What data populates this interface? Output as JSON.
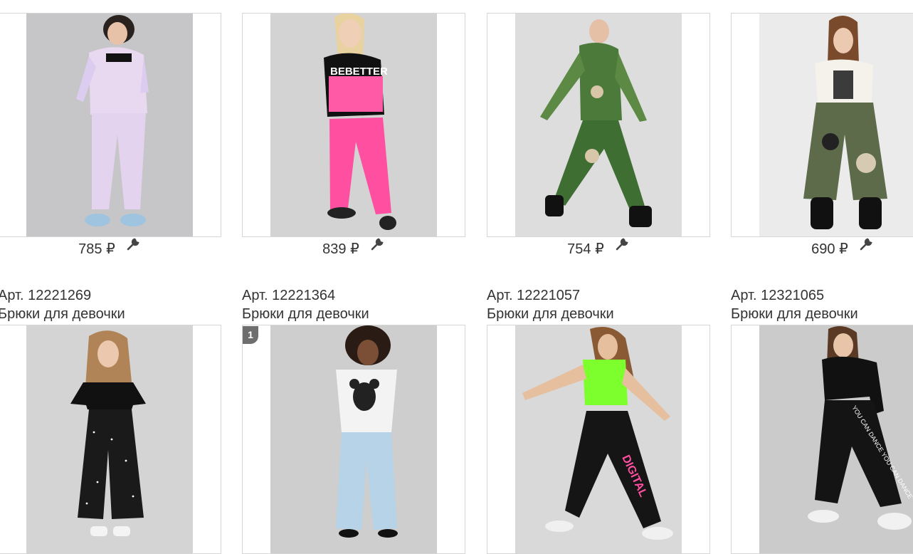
{
  "products": [
    {
      "price": "785 ₽",
      "sku": "Арт. 12221269",
      "name": "Брюки для девочки",
      "photo": "girl in pastel tie-dye hoodie and joggers",
      "bg": "#c9c9cb"
    },
    {
      "price": "839 ₽",
      "sku": "Арт. 12221364",
      "name": "Брюки для девочки",
      "photo": "girl in black and pink hoodie, pink joggers",
      "bg": "#d4d4d4"
    },
    {
      "price": "754 ₽",
      "sku": "Арт. 12221057",
      "name": "Брюки для девочки",
      "photo": "girl in green camouflage tracksuit",
      "bg": "#dcdcdc"
    },
    {
      "price": "690 ₽",
      "sku": "Арт. 12321065",
      "name": "Брюки для девочки",
      "photo": "girl in white t-shirt and camo wide trousers",
      "bg": "#e8e8e8"
    },
    {
      "photo": "girl in black top and polka-dot trousers",
      "bg": "#d2d2d2"
    },
    {
      "badge": "1",
      "photo": "girl in mickey t-shirt and light blue jeans",
      "bg": "#cfcfcf"
    },
    {
      "photo": "girl in neon green top and black digital joggers",
      "bg": "#d8d8d8"
    },
    {
      "photo": "girl in black mesh dance outfit",
      "bg": "#cdcdcd"
    }
  ]
}
